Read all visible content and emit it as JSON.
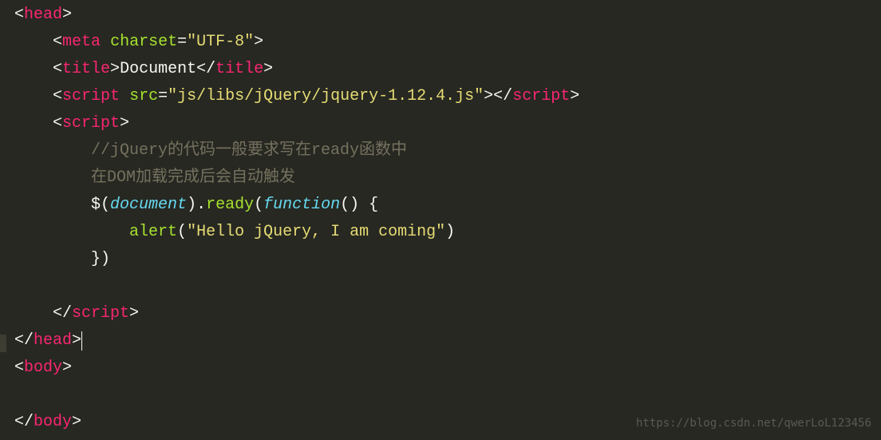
{
  "code": {
    "line1": {
      "open": "<",
      "tag": "head",
      "close": ">"
    },
    "line2": {
      "indent": "    ",
      "open": "<",
      "tag": "meta",
      "attr": "charset",
      "eq": "=",
      "val": "\"UTF-8\"",
      "close": ">"
    },
    "line3": {
      "indent": "    ",
      "open": "<",
      "tag": "title",
      "close1": ">",
      "text": "Document",
      "open2": "</",
      "tag2": "title",
      "close2": ">"
    },
    "line4": {
      "indent": "    ",
      "open": "<",
      "tag": "script",
      "attr": "src",
      "eq": "=",
      "val": "\"js/libs/jQuery/jquery-1.12.4.js\"",
      "close1": "></",
      "tag2": "script",
      "close2": ">"
    },
    "line5": {
      "indent": "    ",
      "open": "<",
      "tag": "script",
      "close": ">"
    },
    "line6": {
      "indent": "        ",
      "comment": "//jQuery的代码一般要求写在ready函数中"
    },
    "line7": {
      "indent": "        ",
      "comment": "在DOM加载完成后会自动触发"
    },
    "line8": {
      "indent": "        ",
      "dollar": "$",
      "p1": "(",
      "var": "document",
      "p2": ")",
      "dot": ".",
      "func": "ready",
      "p3": "(",
      "keyword": "function",
      "p4": "() ",
      "curly": "{"
    },
    "line9": {
      "indent": "            ",
      "func": "alert",
      "p1": "(",
      "string": "\"Hello jQuery, I am coming\"",
      "p2": ")"
    },
    "line10": {
      "indent": "        ",
      "curly": "}",
      "p1": ")"
    },
    "line11": {
      "text": ""
    },
    "line12": {
      "indent": "    ",
      "open": "</",
      "tag": "script",
      "close": ">"
    },
    "line13": {
      "open": "</",
      "tag": "head",
      "close": ">"
    },
    "line14": {
      "open": "<",
      "tag": "body",
      "close": ">"
    },
    "line15": {
      "indent": "    ",
      "text": ""
    },
    "line16": {
      "open": "</",
      "tag": "body",
      "close": ">"
    }
  },
  "watermark": "https://blog.csdn.net/qwerLoL123456"
}
